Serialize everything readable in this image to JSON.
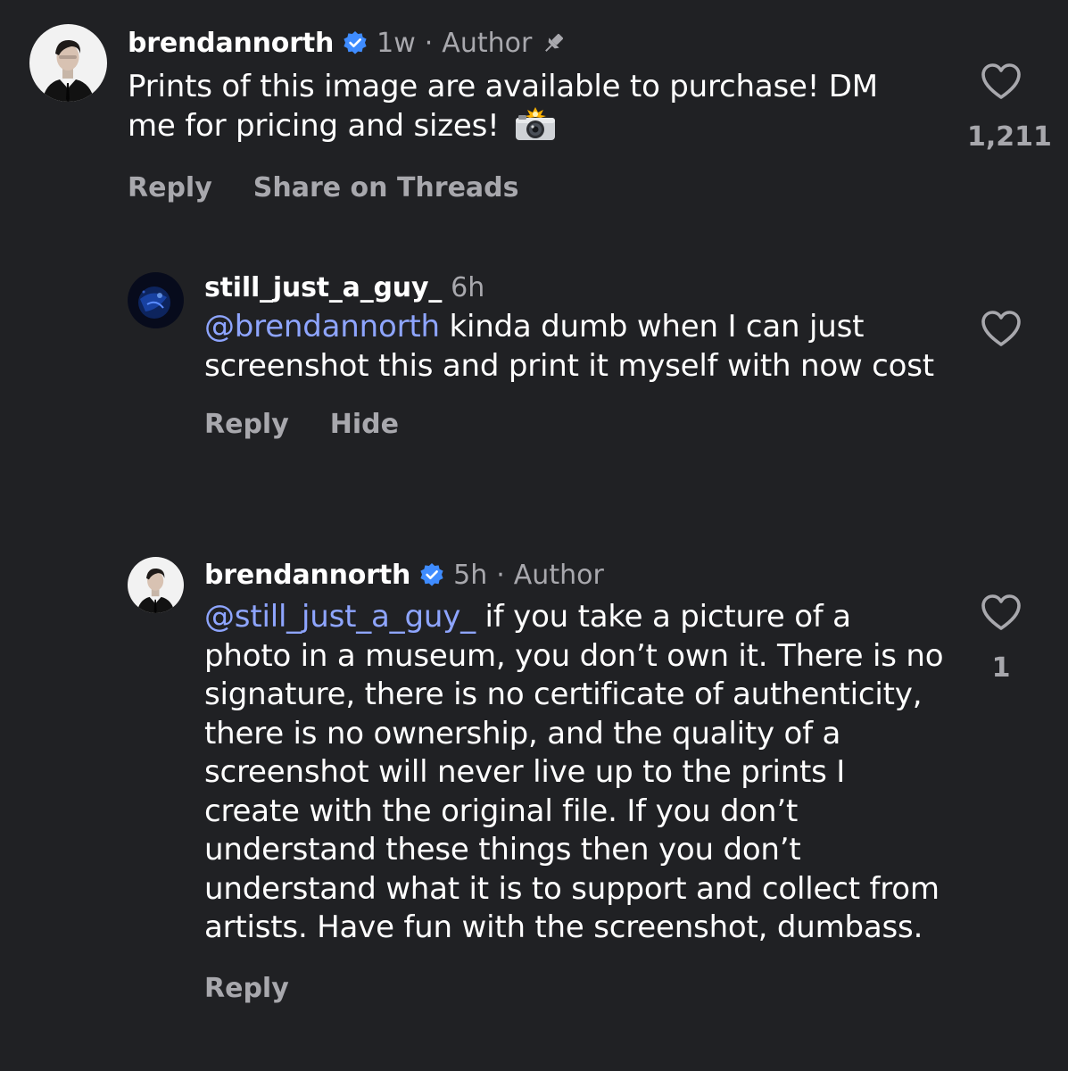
{
  "comments": [
    {
      "username": "brendannorth",
      "verified": true,
      "time": "1w",
      "author_badge": "Author",
      "pinned": true,
      "text": "Prints of this image are available to purchase! DM me for pricing and sizes!",
      "emoji": "camera-with-flash",
      "actions": [
        "Reply",
        "Share on Threads"
      ],
      "likes": "1,211",
      "avatar": "portrait-man-suit-icon"
    },
    {
      "username": "still_just_a_guy_",
      "verified": false,
      "time": "6h",
      "mention": "@brendannorth",
      "text": " kinda dumb when I can just screenshot this and print it myself with now cost",
      "actions": [
        "Reply",
        "Hide"
      ],
      "likes": "",
      "avatar": "dark-blue-abstract-icon"
    },
    {
      "username": "brendannorth",
      "verified": true,
      "time": "5h",
      "author_badge": "Author",
      "mention": "@still_just_a_guy_",
      "text": " if you take a picture of a photo in a museum, you don’t own it. There is no signature, there is no certificate of authenticity, there is no ownership, and the quality of a screenshot will never live up to the prints I create with the original file. If you don’t understand these things then you don’t understand what it is to support and collect from artists. Have fun with the screenshot, dumbass.",
      "actions": [
        "Reply"
      ],
      "likes": "1",
      "avatar": "portrait-man-suit-icon"
    }
  ],
  "colors": {
    "background": "#202124",
    "text": "#ffffff",
    "secondary": "#a8a8ad",
    "mention": "#8ea5ff",
    "verified": "#3f8cff"
  }
}
